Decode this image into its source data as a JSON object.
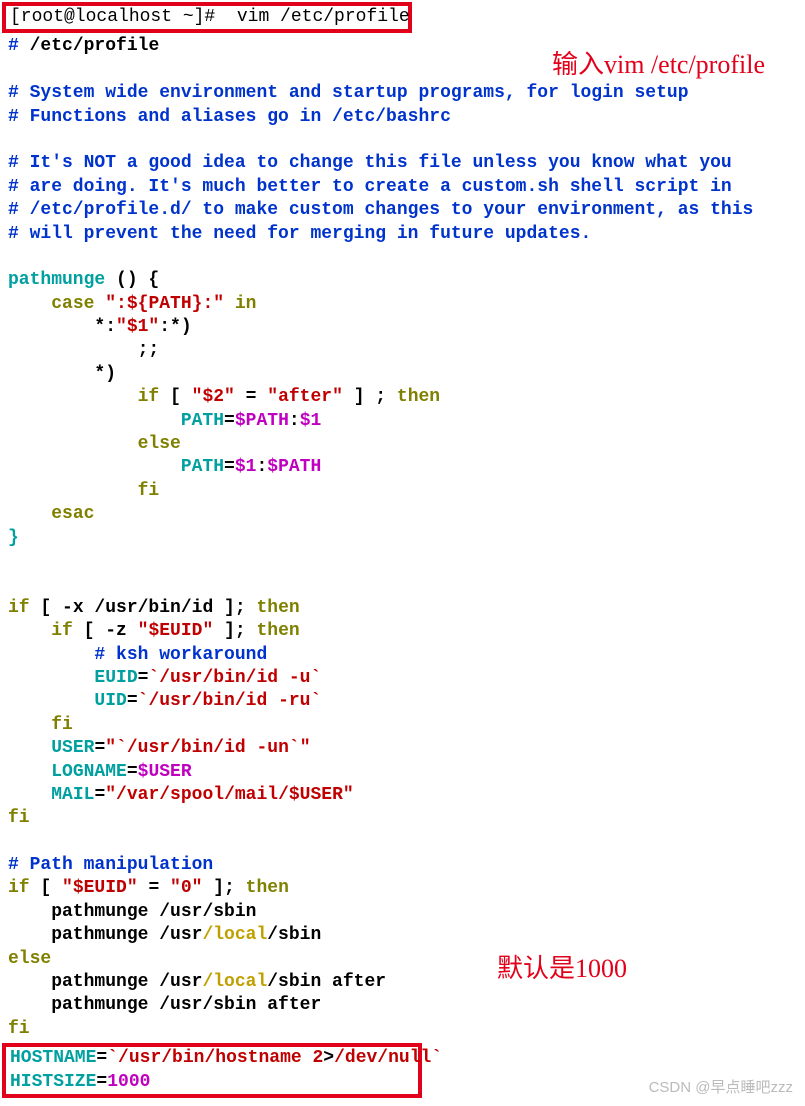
{
  "terminal": {
    "prompt_user": "root",
    "prompt_host": "localhost",
    "prompt_dir": "~",
    "prompt_sym": "#",
    "command": "vim /etc/profile",
    "prompt_full": "[root@localhost ~]#  vim /etc/profile"
  },
  "annotations": {
    "top_right": "输入vim /etc/profile",
    "bottom_right": "默认是1000"
  },
  "watermark": "CSDN @早点睡吧zzz",
  "file_header_marker": "#",
  "file_header_path": "/etc/profile",
  "comments": {
    "l1": "# System wide environment and startup programs, for login setup",
    "l2": "# Functions and aliases go in /etc/bashrc",
    "l3": "# It's NOT a good idea to change this file unless you know what you",
    "l4": "# are doing. It's much better to create a custom.sh shell script in",
    "l5": "# /etc/profile.d/ to make custom changes to your environment, as this",
    "l6": "# will prevent the need for merging in future updates.",
    "ksh": "# ksh workaround",
    "pathman": "# Path manipulation"
  },
  "tokens": {
    "pathmunge_name": "pathmunge",
    "open_paren": " () {",
    "case_kw": "case",
    "case_str": "\":${PATH}:\"",
    "in_kw": " in",
    "pat1a": "*:",
    "pat1b": "\"$1\"",
    "pat1c": ":*)",
    "dsemi": ";;",
    "pat2": "*)",
    "if_kw": "if",
    "lb": " [ ",
    "s2": "\"$2\"",
    "eq": " = ",
    "after": "\"after\"",
    "rb": " ] ; ",
    "then_kw": "then",
    "path_var": "PATH",
    "assign": "=",
    "dpath": "$PATH",
    "colon": ":",
    "d1": "$1",
    "else_kw": "else",
    "fi_kw": "fi",
    "esac_kw": "esac",
    "cbrace": "}",
    "lb2": " [ -x ",
    "idpath": "/usr/bin/id",
    "rb2": " ]; ",
    "lb3": " [ -z ",
    "euid_q": "\"$EUID\"",
    "euid_var": "EUID",
    "backtick_id_u": "`/usr/bin/id -u`",
    "uid_var": "UID",
    "backtick_id_ru": "`/usr/bin/id -ru`",
    "user_var": "USER",
    "user_val_open": "\"",
    "user_val_bt": "`/usr/bin/id -un`",
    "user_val_close": "\"",
    "logname_var": "LOGNAME",
    "duser": "$USER",
    "mail_var": "MAIL",
    "mail_path": "\"/var/spool/mail/$USER\"",
    "zero_str": "\"0\"",
    "pm_call1_a": "    pathmunge /usr",
    "pm_call1_b": "/sbin",
    "pm_local": "/local",
    "pm_call2_pre": "    pathmunge /usr",
    "pm_sbin": "/sbin",
    "pm_after": "/sbin after",
    "hostname_var": "HOSTNAME",
    "hostname_val_open": "`",
    "hostname_path": "/usr/bin/hostname 2",
    "hostname_gt": ">",
    "hostname_devnull": "/dev/null",
    "hostname_val_close": "`",
    "histsize_var": "HISTSIZE",
    "histsize_val": "1000"
  }
}
